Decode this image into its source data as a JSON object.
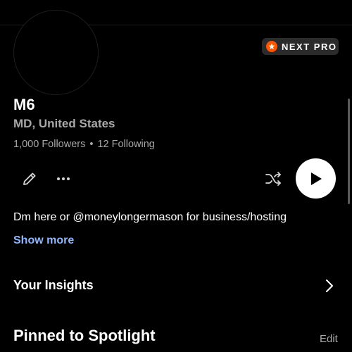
{
  "profile": {
    "badge": {
      "label": "NEXT PRO",
      "icon": "star-icon",
      "icon_color": "#ff5500"
    },
    "name": "M6",
    "location": "MD, United States",
    "followers": "1,000 Followers",
    "separator": "•",
    "following": "12 Following",
    "bio": "Dm here or @moneylongermason for business/hosting",
    "show_more": "Show more"
  },
  "actions": {
    "edit_icon": "pencil-icon",
    "more_icon": "more-dots-icon",
    "shuffle_icon": "shuffle-icon",
    "play_icon": "play-icon"
  },
  "sections": {
    "insights": {
      "label": "Your Insights",
      "icon": "chevron-right-icon"
    },
    "pinned": {
      "title": "Pinned to Spotlight",
      "edit_label": "Edit"
    }
  },
  "colors": {
    "background": "#000000",
    "text": "#ffffff",
    "secondary_text": "#a8a8a8",
    "link": "#8fb6ff",
    "badge_bg": "#2b2b2b"
  }
}
